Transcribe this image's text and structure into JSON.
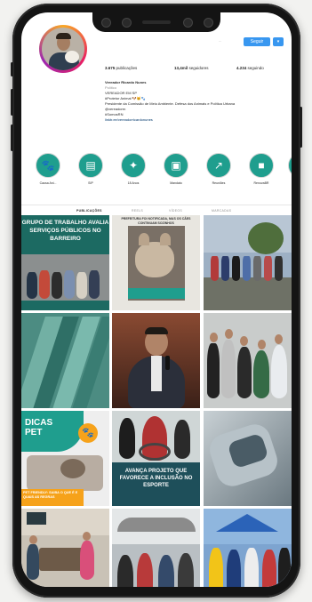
{
  "profile": {
    "follow_label": "Seguir",
    "more_label": "▾",
    "edge_label": "...",
    "posts_count": "3.675",
    "posts_label": "publicações",
    "followers_count": "13,4mil",
    "followers_label": "seguidores",
    "following_count": "4.234",
    "following_label": "seguindo",
    "bio": {
      "name": "Vereador Ricardo Nunes",
      "category": "Político",
      "lines": [
        "VEREADOR EM SP",
        "#Protetor Animal 🐶🐱🐾",
        "Presidente da Comissão de Meio Ambiente. Defesa dos Animais e Política Urbana",
        "@vereadorrn",
        "#SomosRN"
      ],
      "link": "linktr.ee/vereadorricardonunes"
    }
  },
  "highlights": [
    {
      "label": "Causa Ani...",
      "icon": "paw-icon"
    },
    {
      "label": "SIP",
      "icon": "document-icon"
    },
    {
      "label": "18 Anos",
      "icon": "lightbulb-icon"
    },
    {
      "label": "Mandato",
      "icon": "video-icon"
    },
    {
      "label": "Reuniões",
      "icon": "chart-icon"
    },
    {
      "label": "RenovaBR",
      "icon": "camera-icon"
    },
    {
      "label": "",
      "icon": "circle-icon"
    }
  ],
  "tabs": [
    {
      "label": "PUBLICAÇÕES",
      "active": true
    },
    {
      "label": "REELS",
      "active": false
    },
    {
      "label": "VÍDEOS",
      "active": false
    },
    {
      "label": "MARCADAS",
      "active": false
    }
  ],
  "posts": {
    "p1_title": "GRUPO DE TRABALHO AVALIA SERVIÇOS PÚBLICOS NO BARREIRO",
    "p2_caption": "PREFEITURA FOI NOTIFICADA, MAS OS CÃES CONTINUAM SOZINHOS",
    "p2_sub": "dog-photo",
    "p7_title": "DICAS PET",
    "p7_sub": "PET FRIENDLY: SAIBA O QUE É E QUAIS AS REGRAS",
    "p8_title": "AVANÇA PROJETO QUE FAVORECE A INCLUSÃO NO ESPORTE"
  },
  "colors": {
    "accent": "#3897f0",
    "teal": "#1f9e8e",
    "dark_teal": "#1e4f5a",
    "banner_green": "#1c6a62"
  }
}
